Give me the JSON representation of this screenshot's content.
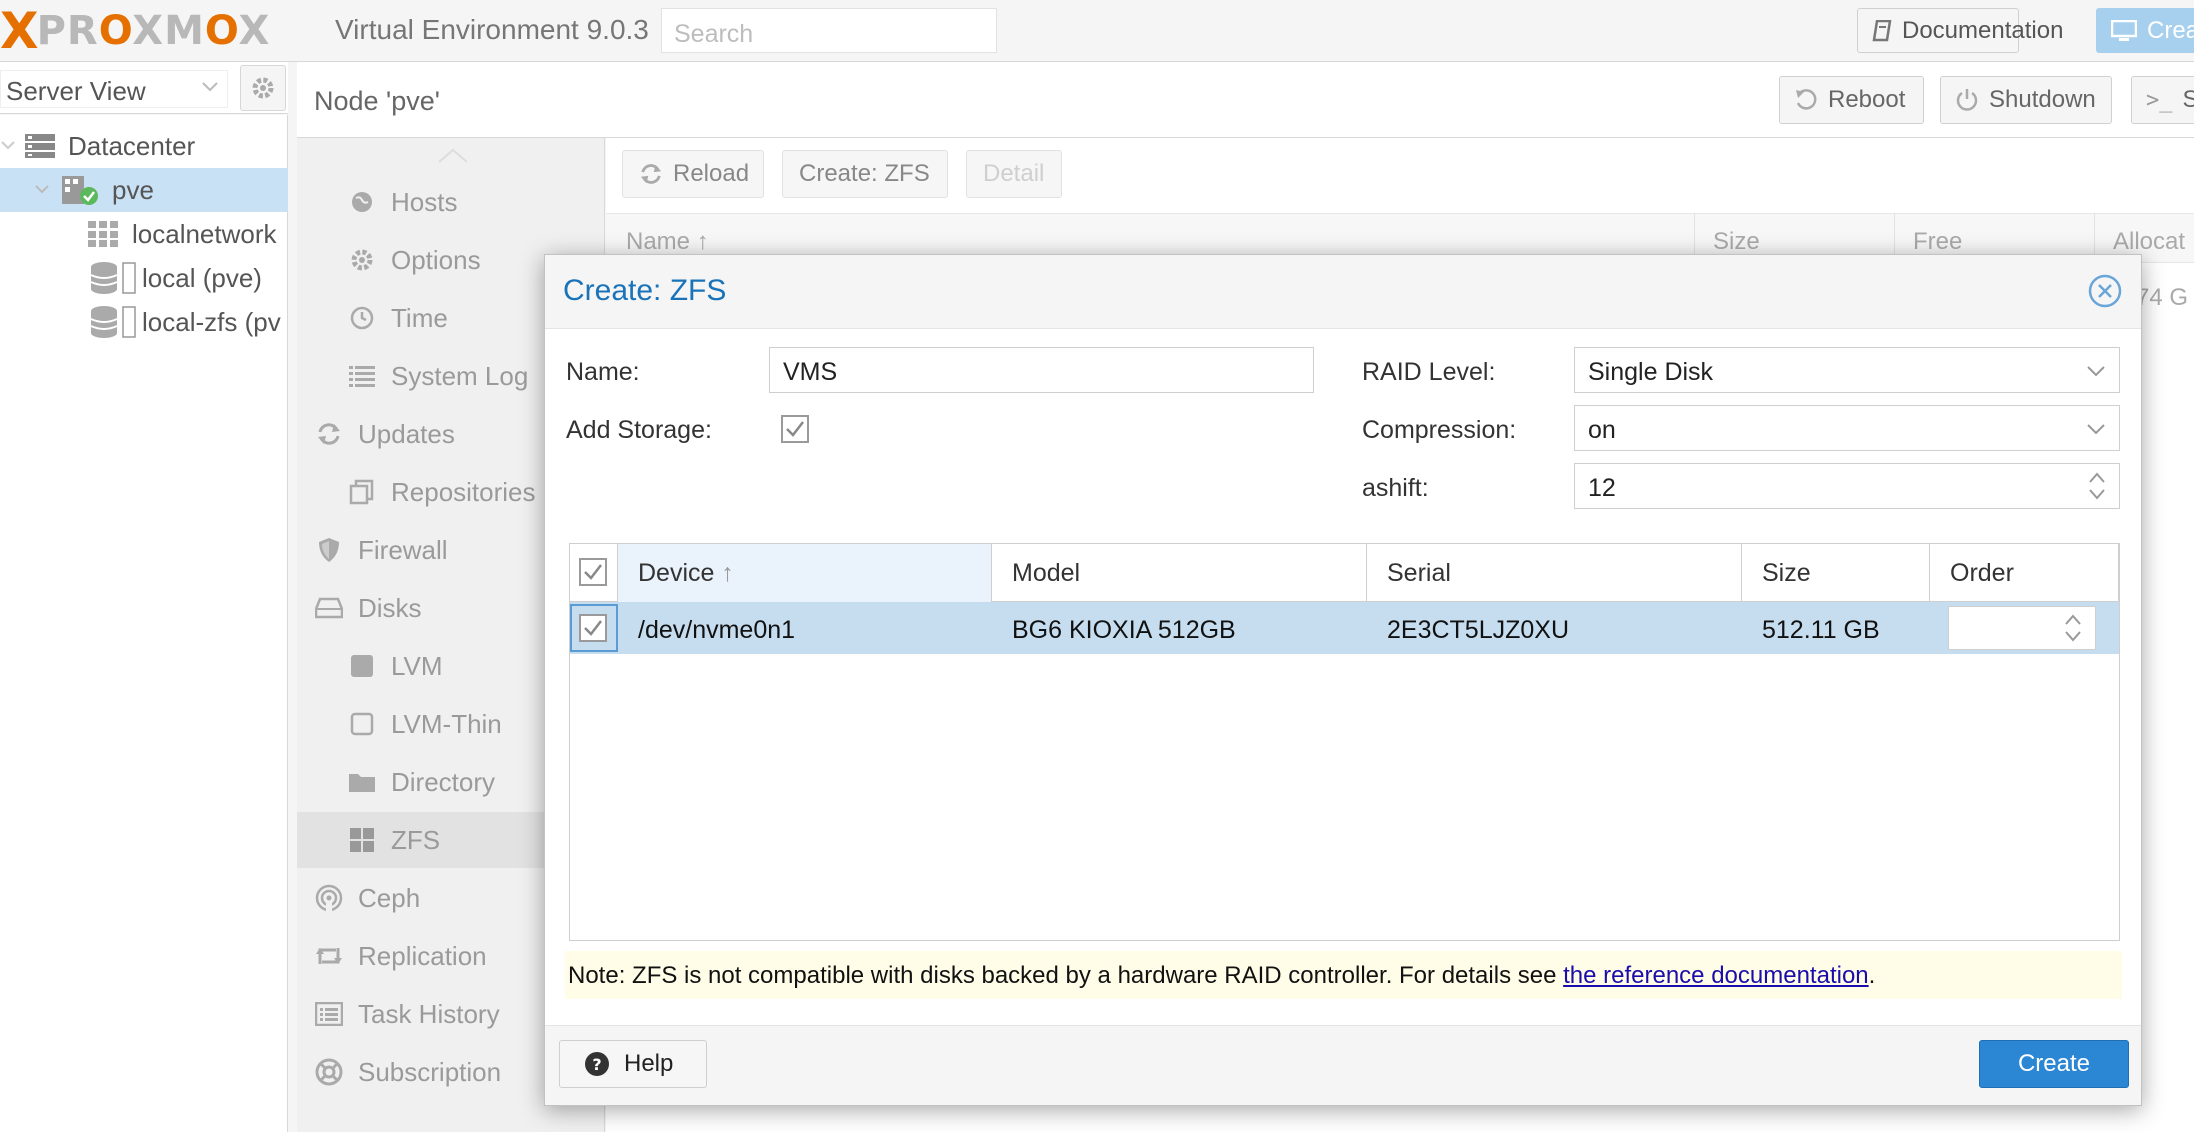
{
  "app": {
    "logo_x": "X",
    "logo_word_a": "PR",
    "logo_word_o1": "O",
    "logo_word_b": "XM",
    "logo_word_o2": "O",
    "logo_word_c": "X",
    "title": "Virtual Environment 9.0.3",
    "search_placeholder": "Search",
    "documentation_label": "Documentation",
    "create_vm_label": "Crea"
  },
  "tree": {
    "view_label": "Server View",
    "items": [
      {
        "label": "Datacenter",
        "icon": "datacenter-icon"
      },
      {
        "label": "pve",
        "icon": "node-online-icon"
      },
      {
        "label": "localnetwork",
        "icon": "sdn-zone-icon"
      },
      {
        "label": "local (pve)",
        "icon": "storage-icon"
      },
      {
        "label": "local-zfs (pv",
        "icon": "storage-icon"
      }
    ]
  },
  "node": {
    "title": "Node 'pve'",
    "reboot_label": "Reboot",
    "shutdown_label": "Shutdown",
    "shell_label": "S"
  },
  "submenu": {
    "items": [
      {
        "label": "Hosts",
        "icon": "globe-icon"
      },
      {
        "label": "Options",
        "icon": "gear-icon"
      },
      {
        "label": "Time",
        "icon": "clock-icon"
      },
      {
        "label": "System Log",
        "icon": "list-icon"
      },
      {
        "label": "Updates",
        "icon": "refresh-icon"
      },
      {
        "label": "Repositories",
        "icon": "copy-icon"
      },
      {
        "label": "Firewall",
        "icon": "shield-icon"
      },
      {
        "label": "Disks",
        "icon": "hdd-icon"
      },
      {
        "label": "LVM",
        "icon": "square-icon"
      },
      {
        "label": "LVM-Thin",
        "icon": "square-outline-icon"
      },
      {
        "label": "Directory",
        "icon": "folder-icon"
      },
      {
        "label": "ZFS",
        "icon": "grid-icon"
      },
      {
        "label": "Ceph",
        "icon": "ceph-icon"
      },
      {
        "label": "Replication",
        "icon": "retweet-icon"
      },
      {
        "label": "Task History",
        "icon": "list-alt-icon"
      },
      {
        "label": "Subscription",
        "icon": "support-icon"
      }
    ]
  },
  "content": {
    "reload_label": "Reload",
    "create_zfs_label": "Create: ZFS",
    "detail_label": "Detail",
    "columns": [
      "Name",
      "Size",
      "Free",
      "Allocat"
    ],
    "row_partial": "74 G"
  },
  "dialog": {
    "title": "Create: ZFS",
    "name_label": "Name:",
    "name_value": "VMS",
    "add_storage_label": "Add Storage:",
    "add_storage_checked": true,
    "raid_label": "RAID Level:",
    "raid_value": "Single Disk",
    "compression_label": "Compression:",
    "compression_value": "on",
    "ashift_label": "ashift:",
    "ashift_value": "12",
    "disk_columns": [
      "Device",
      "Model",
      "Serial",
      "Size",
      "Order"
    ],
    "disks": [
      {
        "device": "/dev/nvme0n1",
        "model": "BG6 KIOXIA 512GB",
        "serial": "2E3CT5LJZ0XU",
        "size": "512.11 GB",
        "order": ""
      }
    ],
    "note_text": "Note: ZFS is not compatible with disks backed by a hardware RAID controller. For details see ",
    "note_link": "the reference documentation",
    "note_end": ".",
    "help_label": "Help",
    "create_label": "Create"
  },
  "colors": {
    "accent": "#2b87d3",
    "brand_orange": "#e57000",
    "selection": "#c6ddf0",
    "note_bg": "#fffde8"
  }
}
